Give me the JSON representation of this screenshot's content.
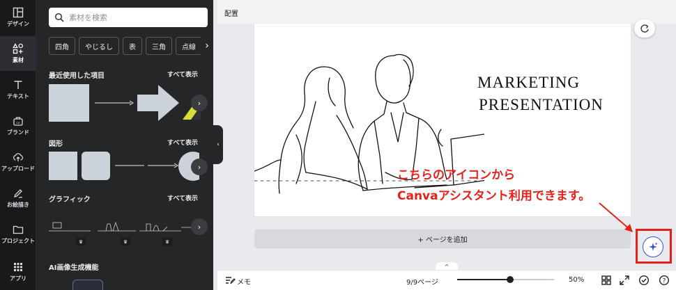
{
  "rail": {
    "items": [
      {
        "label": "デザイン",
        "icon": "layout-icon"
      },
      {
        "label": "素材",
        "icon": "elements-icon",
        "active": true
      },
      {
        "label": "テキスト",
        "icon": "text-icon"
      },
      {
        "label": "ブランド",
        "icon": "brand-icon"
      },
      {
        "label": "アップロード",
        "icon": "upload-icon"
      },
      {
        "label": "お絵描き",
        "icon": "draw-icon"
      },
      {
        "label": "プロジェクト",
        "icon": "folder-icon"
      },
      {
        "label": "アプリ",
        "icon": "apps-icon"
      }
    ]
  },
  "panel": {
    "search_placeholder": "素材を検索",
    "chips": [
      "四角",
      "やじるし",
      "表",
      "三角",
      "点線"
    ],
    "recent": {
      "title": "最近使用した項目",
      "more": "すべて表示"
    },
    "shapes": {
      "title": "図形",
      "more": "すべて表示"
    },
    "graphics": {
      "title": "グラフィック",
      "more": "すべて表示"
    },
    "ai": {
      "title": "AI画像生成機能"
    }
  },
  "topbar": {
    "title": "配置"
  },
  "slide": {
    "line1": "MARKETING",
    "line2": "PRESENTATION"
  },
  "canvas": {
    "add_page": "+ ページを追加"
  },
  "annotation": {
    "line1": "こちらのアイコンから",
    "line2": "Canvaアシスタント利用できます。",
    "color": "#e6211a"
  },
  "bottombar": {
    "notes": "メモ",
    "page_counter": "9/9ページ",
    "zoom_level": 50,
    "zoom_label": "50%"
  }
}
